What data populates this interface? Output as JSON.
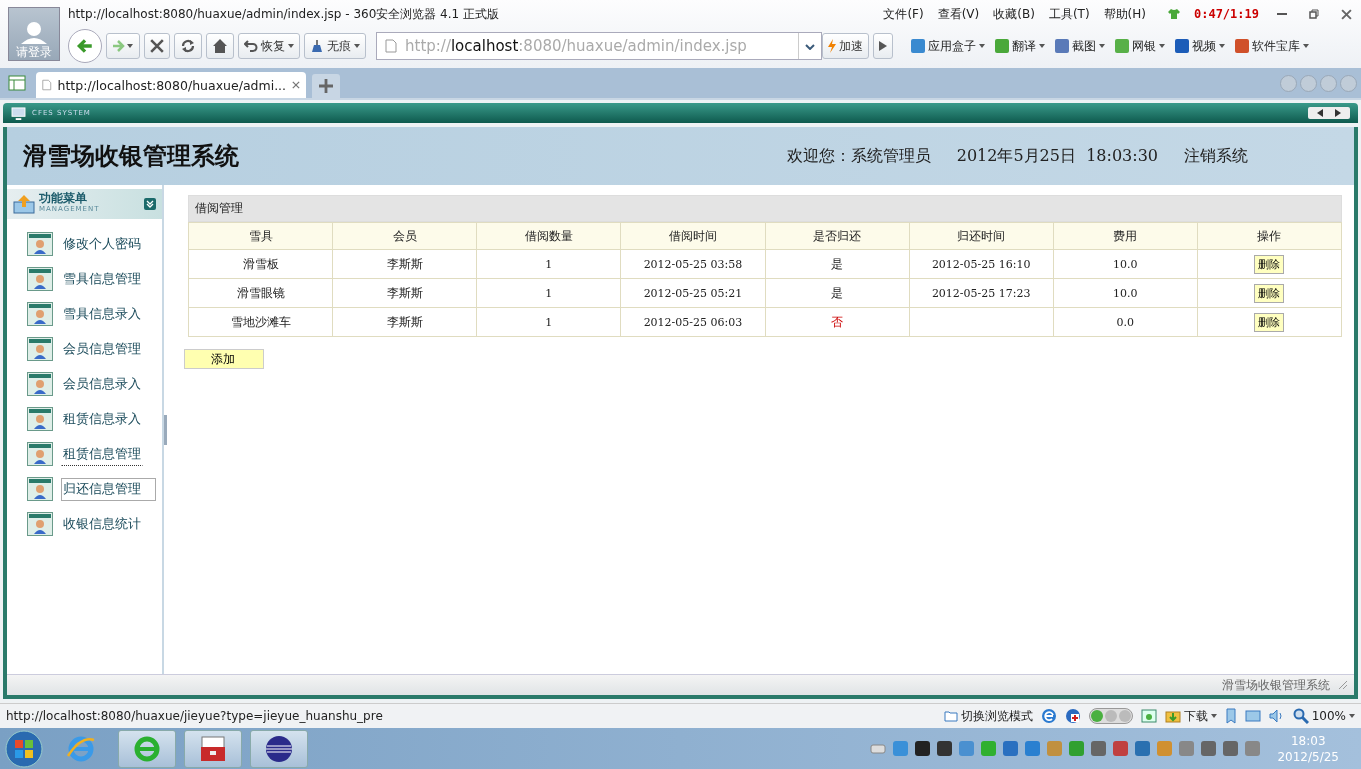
{
  "browser": {
    "title": "http://localhost:8080/huaxue/admin/index.jsp - 360安全浏览器 4.1 正式版",
    "login": "请登录",
    "menu": [
      "文件(F)",
      "查看(V)",
      "收藏(B)",
      "工具(T)",
      "帮助(H)"
    ],
    "timer": "0:47/1:19",
    "restore": "恢复",
    "incognito": "无痕",
    "address_scheme": "http://",
    "address_host": "localhost",
    "address_rest": ":8080/huaxue/admin/index.jsp",
    "speedup": "加速",
    "toolbar": [
      {
        "label": "应用盒子",
        "color": "#3a8ad0"
      },
      {
        "label": "翻译",
        "color": "#4aa83a"
      },
      {
        "label": "截图",
        "color": "#5a7ab8"
      },
      {
        "label": "网银",
        "color": "#58b048"
      },
      {
        "label": "视频",
        "color": "#1c5cb8"
      },
      {
        "label": "软件宝库",
        "color": "#d0502a"
      }
    ],
    "tab": "http://localhost:8080/huaxue/admi..."
  },
  "app": {
    "brand": "CFES SYSTEM",
    "title": "滑雪场收银管理系统",
    "welcome": "欢迎您：系统管理员",
    "datetime": "2012年5月25日  18:03:30",
    "logout": "注销系统",
    "menu_title": "功能菜单",
    "menu_sub": "MANAGEMENT",
    "menu": [
      {
        "label": "修改个人密码",
        "selected": false,
        "focused": false
      },
      {
        "label": "雪具信息管理",
        "selected": false,
        "focused": false
      },
      {
        "label": "雪具信息录入",
        "selected": false,
        "focused": false
      },
      {
        "label": "会员信息管理",
        "selected": false,
        "focused": false
      },
      {
        "label": "会员信息录入",
        "selected": false,
        "focused": false
      },
      {
        "label": "租赁信息录入",
        "selected": false,
        "focused": false
      },
      {
        "label": "租赁信息管理",
        "selected": false,
        "focused": true
      },
      {
        "label": "归还信息管理",
        "selected": true,
        "focused": false
      },
      {
        "label": "收银信息统计",
        "selected": false,
        "focused": false
      }
    ],
    "panel_title": "借阅管理",
    "columns": [
      "雪具",
      "会员",
      "借阅数量",
      "借阅时间",
      "是否归还",
      "归还时间",
      "费用",
      "操作"
    ],
    "rows": [
      {
        "gear": "滑雪板",
        "member": "李斯斯",
        "qty": "1",
        "borrowed": "2012-05-25 03:58",
        "returned_text": "是",
        "returned": true,
        "return_time": "2012-05-25 16:10",
        "fee": "10.0",
        "action": "删除"
      },
      {
        "gear": "滑雪眼镜",
        "member": "李斯斯",
        "qty": "1",
        "borrowed": "2012-05-25 05:21",
        "returned_text": "是",
        "returned": true,
        "return_time": "2012-05-25 17:23",
        "fee": "10.0",
        "action": "删除"
      },
      {
        "gear": "雪地沙滩车",
        "member": "李斯斯",
        "qty": "1",
        "borrowed": "2012-05-25 06:03",
        "returned_text": "否",
        "returned": false,
        "fee": "0.0",
        "action": "删除"
      }
    ],
    "add": "添加",
    "footer": "滑雪场收银管理系统"
  },
  "status": {
    "url": "http://localhost:8080/huaxue/jieyue?type=jieyue_huanshu_pre",
    "mode": "切换浏览模式",
    "download": "下载",
    "zoom": "100%"
  },
  "taskbar": {
    "time": "18:03",
    "date": "2012/5/25"
  }
}
